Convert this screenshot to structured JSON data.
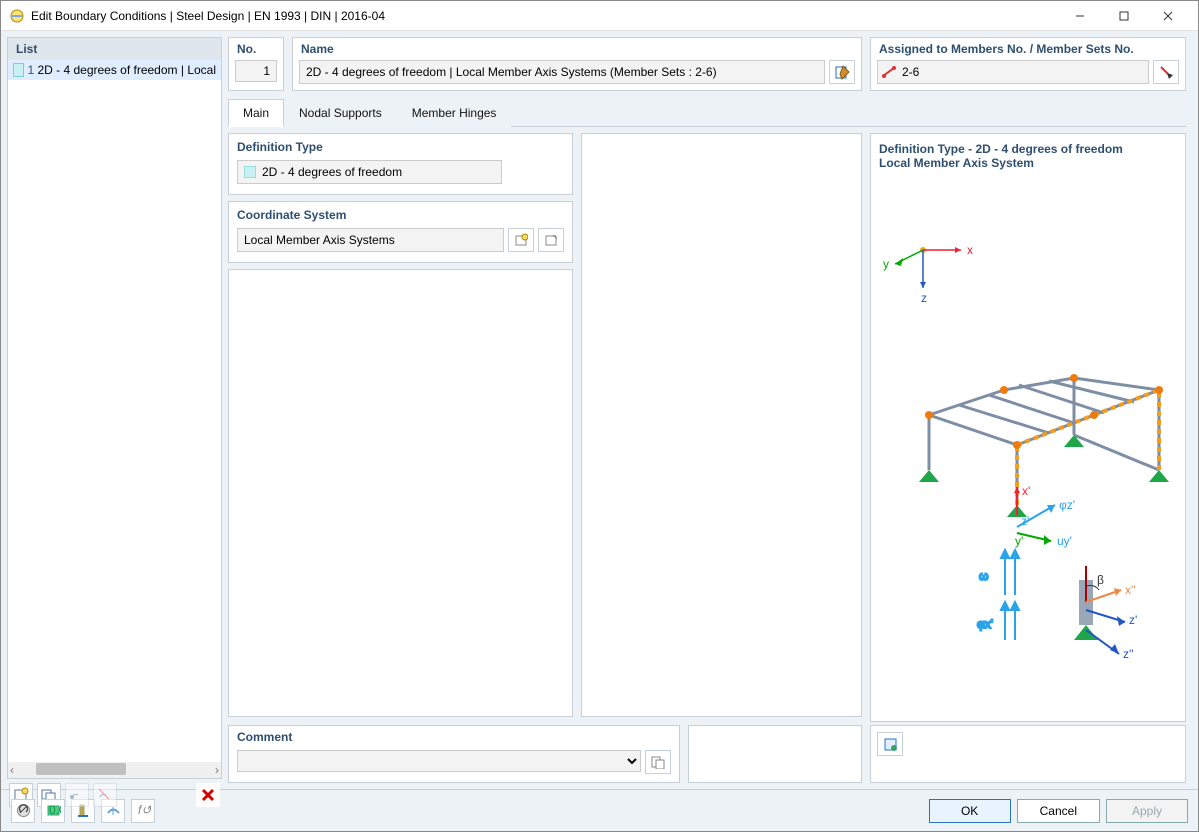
{
  "window": {
    "title": "Edit Boundary Conditions | Steel Design | EN 1993 | DIN | 2016-04"
  },
  "left": {
    "title": "List",
    "items": [
      {
        "num": "1",
        "label": "2D - 4 degrees of freedom | Local"
      }
    ]
  },
  "top": {
    "no_label": "No.",
    "no_value": "1",
    "name_label": "Name",
    "name_value": "2D - 4 degrees of freedom | Local Member Axis Systems (Member Sets : 2-6)",
    "assigned_label": "Assigned to Members No. / Member Sets No.",
    "assigned_value": "2-6"
  },
  "tabs": [
    "Main",
    "Nodal Supports",
    "Member Hinges"
  ],
  "main": {
    "def_title": "Definition Type",
    "def_value": "2D - 4 degrees of freedom",
    "cs_title": "Coordinate System",
    "cs_value": "Local Member Axis Systems",
    "comment_title": "Comment"
  },
  "preview": {
    "title": "Definition Type - 2D - 4 degrees of freedom",
    "sub": "Local Member Axis System",
    "axis_x": "x",
    "axis_y": "y",
    "axis_z": "z",
    "lbl_x2": "x'",
    "lbl_z2": "z'",
    "lbl_y2": "y'",
    "lbl_phiz": "φz'",
    "lbl_uy": "uy'",
    "lbl_omega": "ω",
    "lbl_phix": "φx'",
    "lbl_beta": "β",
    "lbl_xpp": "x''",
    "lbl_zpp": "z'",
    "lbl_zpp2": "z''"
  },
  "buttons": {
    "ok": "OK",
    "cancel": "Cancel",
    "apply": "Apply"
  }
}
